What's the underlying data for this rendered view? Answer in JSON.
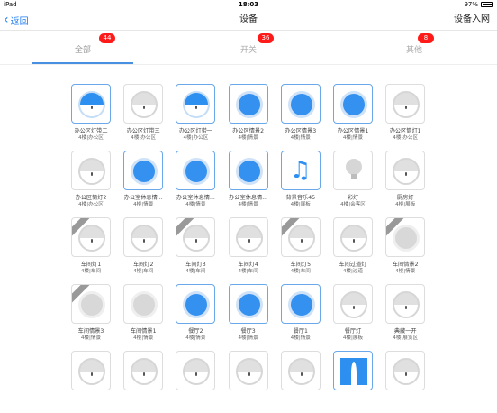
{
  "status": {
    "device": "iPad",
    "time": "18:03",
    "battery": "97%"
  },
  "nav": {
    "back_label": "返回",
    "title": "设备",
    "right_label": "设备入网"
  },
  "tabs": [
    {
      "label": "全部",
      "badge": "44",
      "selected": true
    },
    {
      "label": "开关",
      "badge": "36",
      "selected": false
    },
    {
      "label": "其他",
      "badge": "8",
      "selected": false
    }
  ],
  "colors": {
    "accent": "#1e7cf0",
    "badge": "#ff1a1a",
    "tile_active": "#2d8ff0"
  },
  "devices": [
    {
      "name": "办公区灯带二",
      "room": "4楼|办公区",
      "icon": "half-blue-light-icon",
      "style": "half",
      "active": true,
      "ribbon": false
    },
    {
      "name": "办公区灯带三",
      "room": "4楼|办公区",
      "icon": "half-gray-light-icon",
      "style": "halfGray",
      "active": false,
      "ribbon": false
    },
    {
      "name": "办公区灯带一",
      "room": "4楼|办公区",
      "icon": "half-blue-light-icon",
      "style": "half",
      "active": true,
      "ribbon": false
    },
    {
      "name": "办公区情景2",
      "room": "4楼|情景",
      "icon": "scene-blue-icon",
      "style": "blueFull",
      "active": true,
      "ribbon": false
    },
    {
      "name": "办公区情景3",
      "room": "4楼|情景",
      "icon": "scene-blue-icon",
      "style": "blueFull",
      "active": true,
      "ribbon": false
    },
    {
      "name": "办公区情景1",
      "room": "4楼|情景",
      "icon": "scene-blue-icon",
      "style": "blueFull",
      "active": true,
      "ribbon": false
    },
    {
      "name": "办公区筒灯1",
      "room": "4楼|办公区",
      "icon": "half-gray-light-icon",
      "style": "halfGray",
      "active": false,
      "ribbon": false
    },
    {
      "name": "办公区筒灯2",
      "room": "4楼|办公区",
      "icon": "half-gray-light-icon",
      "style": "halfGray",
      "active": false,
      "ribbon": false
    },
    {
      "name": "办公室休息情...",
      "room": "4楼|情景",
      "icon": "scene-blue-icon",
      "style": "blueFull",
      "active": true,
      "ribbon": false
    },
    {
      "name": "办公室休息情...",
      "room": "4楼|情景",
      "icon": "scene-blue-icon",
      "style": "blueFull",
      "active": true,
      "ribbon": false
    },
    {
      "name": "办公室休息情...",
      "room": "4楼|情景",
      "icon": "scene-blue-icon",
      "style": "blueFull",
      "active": true,
      "ribbon": false
    },
    {
      "name": "背景音乐45",
      "room": "4楼|展板",
      "icon": "music-icon",
      "style": "music",
      "active": true,
      "ribbon": false
    },
    {
      "name": "彩灯",
      "room": "4楼|会客区",
      "icon": "bulb-icon",
      "style": "bulb",
      "active": false,
      "ribbon": false
    },
    {
      "name": "厨房灯",
      "room": "4楼|展板",
      "icon": "half-gray-light-icon",
      "style": "halfGray",
      "active": false,
      "ribbon": false
    },
    {
      "name": "车间灯1",
      "room": "4楼|车间",
      "icon": "half-gray-light-icon",
      "style": "halfGray",
      "active": false,
      "ribbon": true
    },
    {
      "name": "车间灯2",
      "room": "4楼|车间",
      "icon": "half-gray-light-icon",
      "style": "halfGray",
      "active": false,
      "ribbon": false
    },
    {
      "name": "车间灯3",
      "room": "4楼|车间",
      "icon": "half-gray-light-icon",
      "style": "halfGray",
      "active": false,
      "ribbon": true
    },
    {
      "name": "车间灯4",
      "room": "4楼|车间",
      "icon": "half-gray-light-icon",
      "style": "halfGray",
      "active": false,
      "ribbon": false
    },
    {
      "name": "车间灯5",
      "room": "4楼|车间",
      "icon": "half-gray-light-icon",
      "style": "halfGray",
      "active": false,
      "ribbon": true
    },
    {
      "name": "车间过道灯",
      "room": "4楼|过道",
      "icon": "half-gray-light-icon",
      "style": "halfGray",
      "active": false,
      "ribbon": false
    },
    {
      "name": "车间情景2",
      "room": "4楼|情景",
      "icon": "scene-gray-icon",
      "style": "grayFull",
      "active": false,
      "ribbon": true
    },
    {
      "name": "车间情景3",
      "room": "4楼|情景",
      "icon": "scene-gray-icon",
      "style": "grayFull",
      "active": false,
      "ribbon": true
    },
    {
      "name": "车间情景1",
      "room": "4楼|情景",
      "icon": "scene-gray-icon",
      "style": "grayFull",
      "active": false,
      "ribbon": false
    },
    {
      "name": "餐厅2",
      "room": "4楼|情景",
      "icon": "scene-blue-icon",
      "style": "blueFull",
      "active": true,
      "ribbon": false
    },
    {
      "name": "餐厅3",
      "room": "4楼|情景",
      "icon": "scene-blue-icon",
      "style": "blueFull",
      "active": true,
      "ribbon": false
    },
    {
      "name": "餐厅1",
      "room": "4楼|情景",
      "icon": "scene-blue-icon",
      "style": "blueFull",
      "active": true,
      "ribbon": false
    },
    {
      "name": "餐厅灯",
      "room": "4楼|展板",
      "icon": "half-gray-light-icon",
      "style": "halfGray",
      "active": false,
      "ribbon": false
    },
    {
      "name": "典藏一开",
      "room": "4楼|展览区",
      "icon": "half-gray-light-icon",
      "style": "halfGray",
      "active": false,
      "ribbon": false
    },
    {
      "name": "",
      "room": "",
      "icon": "half-gray-light-icon",
      "style": "halfGray",
      "active": false,
      "ribbon": false
    },
    {
      "name": "",
      "room": "",
      "icon": "half-gray-light-icon",
      "style": "halfGray",
      "active": false,
      "ribbon": false
    },
    {
      "name": "",
      "room": "",
      "icon": "half-gray-light-icon",
      "style": "halfGray",
      "active": false,
      "ribbon": false
    },
    {
      "name": "",
      "room": "",
      "icon": "half-gray-light-icon",
      "style": "halfGray",
      "active": false,
      "ribbon": false
    },
    {
      "name": "",
      "room": "",
      "icon": "half-gray-light-icon",
      "style": "halfGray",
      "active": false,
      "ribbon": false
    },
    {
      "name": "",
      "room": "",
      "icon": "curtain-icon",
      "style": "curtain",
      "active": true,
      "ribbon": false
    },
    {
      "name": "",
      "room": "",
      "icon": "half-gray-light-icon",
      "style": "halfGray",
      "active": false,
      "ribbon": false
    }
  ]
}
